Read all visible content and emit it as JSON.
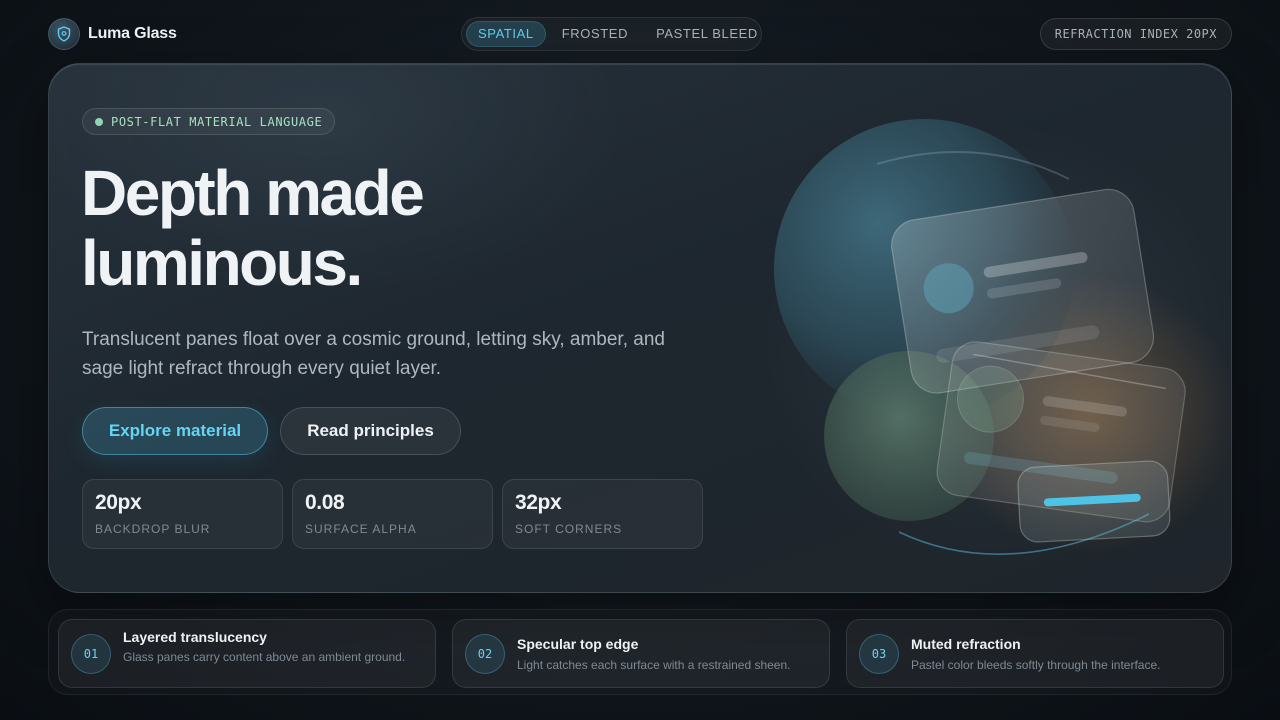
{
  "brand": {
    "name": "Luma Glass",
    "icon": "shield-icon"
  },
  "nav": {
    "segments": [
      {
        "label": "SPATIAL",
        "active": true
      },
      {
        "label": "FROSTED",
        "active": false
      },
      {
        "label": "PASTEL BLEED",
        "active": false
      }
    ],
    "refraction_label": "REFRACTION INDEX 20PX"
  },
  "hero": {
    "eyebrow": "POST-FLAT MATERIAL LANGUAGE",
    "headline_line1": "Depth made",
    "headline_line2": "luminous.",
    "subhead": "Translucent panes float over a cosmic ground, letting sky, amber, and sage light refract through every quiet layer.",
    "primary_cta": "Explore material",
    "secondary_cta": "Read principles",
    "stats": [
      {
        "value": "20px",
        "label": "BACKDROP BLUR"
      },
      {
        "value": "0.08",
        "label": "SURFACE ALPHA"
      },
      {
        "value": "32px",
        "label": "SOFT CORNERS"
      }
    ]
  },
  "features": [
    {
      "num": "01",
      "title": "Layered translucency",
      "desc": "Glass panes carry content above an ambient ground."
    },
    {
      "num": "02",
      "title": "Specular top edge",
      "desc": "Light catches each surface with a restrained sheen."
    },
    {
      "num": "03",
      "title": "Muted refraction",
      "desc": "Pastel color bleeds softly through the interface."
    }
  ],
  "colors": {
    "accent_sky": "#5fd0f0",
    "accent_sage": "#8fd6b0",
    "accent_amber": "#c8894a",
    "background": "#10161c"
  }
}
